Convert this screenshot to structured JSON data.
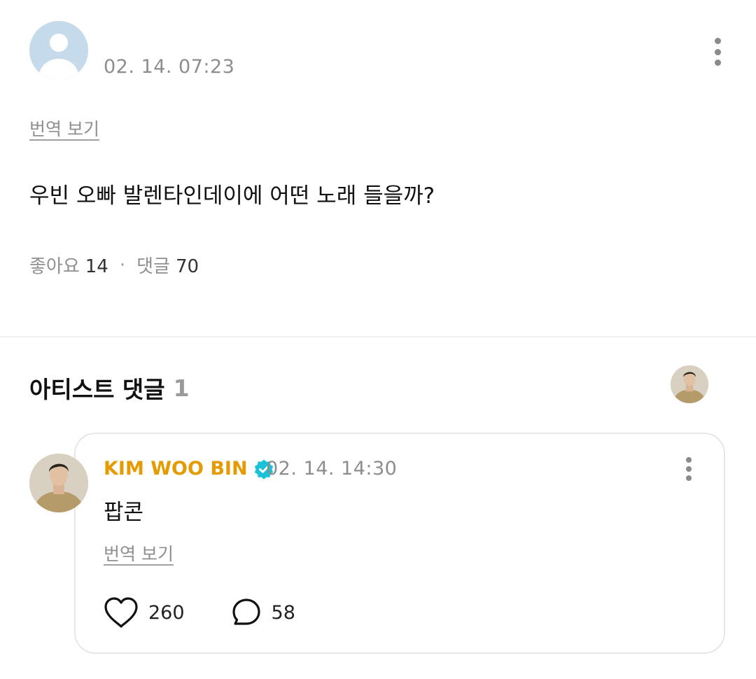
{
  "post": {
    "timestamp": "02. 14. 07:23",
    "translate_label": "번역 보기",
    "body": "우빈 오빠 발렌타인데이에 어떤 노래 들을까?",
    "likes_label": "좋아요",
    "likes_count": "14",
    "stat_separator": "·",
    "comments_label": "댓글",
    "comments_count": "70"
  },
  "artist_comments": {
    "title": "아티스트 댓글",
    "count": "1"
  },
  "comment": {
    "author": "KIM WOO BIN",
    "timestamp": "02. 14. 14:30",
    "text": "팝콘",
    "translate_label": "번역 보기",
    "likes_count": "260",
    "replies_count": "58"
  },
  "colors": {
    "author_name": "#e39b00",
    "verified_badge": "#19c2d6",
    "default_avatar_bg": "#c5daea",
    "muted_text": "#8d8d8d"
  },
  "icons": {
    "post_more": "more-vertical-icon",
    "comment_more": "more-vertical-icon",
    "verified": "verified-badge-icon",
    "like": "heart-icon",
    "reply": "speech-bubble-icon"
  }
}
